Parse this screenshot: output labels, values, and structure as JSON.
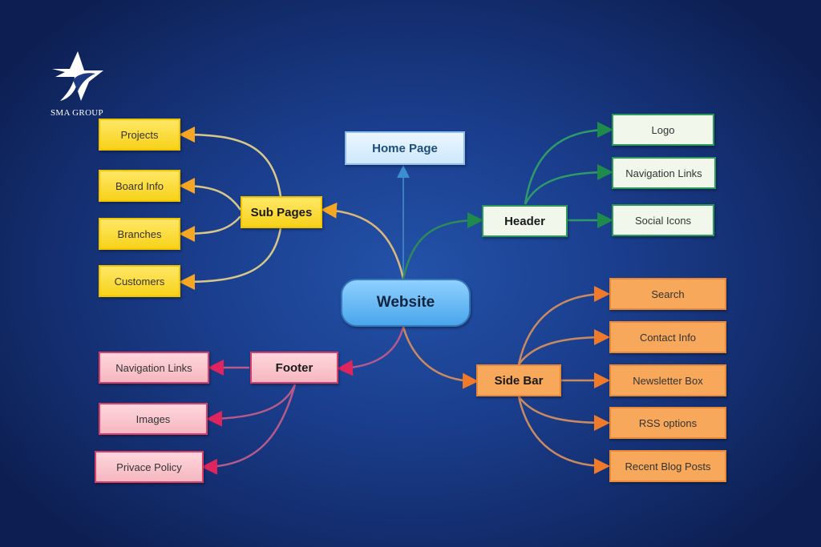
{
  "brand": {
    "name": "SMA GROUP",
    "icon": "star-bird-icon"
  },
  "diagram": {
    "center": {
      "label": "Website"
    },
    "home_page": {
      "label": "Home Page"
    },
    "sub_pages": {
      "label": "Sub Pages",
      "children": [
        "Projects",
        "Board Info",
        "Branches",
        "Customers"
      ],
      "color": "#f7d21a"
    },
    "header": {
      "label": "Header",
      "children": [
        "Logo",
        "Navigation Links",
        "Social Icons"
      ],
      "color": "#2e9a5a"
    },
    "side_bar": {
      "label": "Side Bar",
      "children": [
        "Search",
        "Contact Info",
        "Newsletter Box",
        "RSS options",
        "Recent Blog Posts"
      ],
      "color": "#f7a85a"
    },
    "footer": {
      "label": "Footer",
      "children": [
        "Navigation Links",
        "Images",
        "Privace Policy"
      ],
      "color": "#d8406a"
    }
  }
}
